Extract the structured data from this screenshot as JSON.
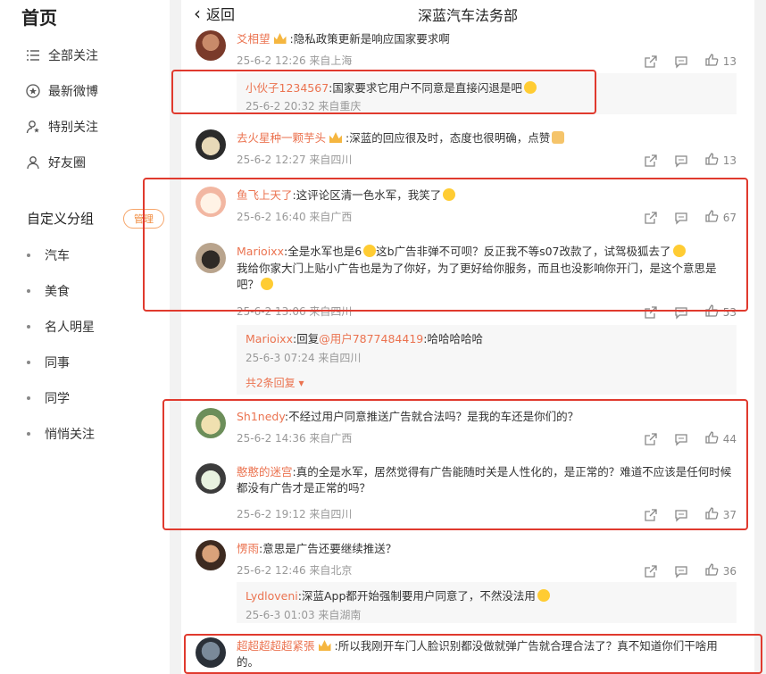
{
  "sidebar": {
    "home": "首页",
    "nav": [
      {
        "label": "全部关注",
        "icon": "list-icon"
      },
      {
        "label": "最新微博",
        "icon": "star-circle-icon"
      },
      {
        "label": "特别关注",
        "icon": "user-star-icon"
      },
      {
        "label": "好友圈",
        "icon": "user-icon"
      }
    ],
    "group_header": "自定义分组",
    "manage": "管理",
    "groups": [
      "汽车",
      "美食",
      "名人明星",
      "同事",
      "同学",
      "悄悄关注"
    ]
  },
  "header": {
    "back": "返回",
    "title": "深蓝汽车法务部"
  },
  "comments": [
    {
      "user": "爻相望",
      "text": ":隐私政策更新是响应国家要求啊",
      "meta": "25-6-2 12:26 来自上海",
      "likes": "13"
    },
    {
      "user": "小伙子1234567",
      "text": ":国家要求它用户不同意是直接闪退是吧",
      "meta": "25-6-2 20:32 来自重庆"
    },
    {
      "user": "去火星种一颗芋头",
      "text": ":深蓝的回应很及时，态度也很明确，点赞",
      "meta": "25-6-2 12:27 来自四川",
      "likes": "13"
    },
    {
      "user": "鱼飞上天了",
      "text": ":这评论区清一色水军，我笑了",
      "meta": "25-6-2 16:40 来自广西",
      "likes": "67"
    },
    {
      "user": "Marioixx",
      "text_a": ":全是水军也是6",
      "text_b": "这b广告非弹不可呗？反正我不等s07改款了，试驾极狐去了",
      "text_c": "我给你家大门上贴小广告也是为了你好，为了更好给你服务，而且也没影响你开门，是这个意思是吧？",
      "meta": "25-6-2 13:06 来自四川",
      "likes": "53"
    },
    {
      "reply_user": "Marioixx",
      "reply_text_a": ":回复",
      "reply_mention": "@用户7877484419",
      "reply_text_b": ":哈哈哈哈哈",
      "reply_meta": "25-6-3 07:24 来自四川",
      "more": "共2条回复"
    },
    {
      "user": "Sh1nedy",
      "text": ":不经过用户同意推送广告就合法吗？是我的车还是你们的？",
      "meta": "25-6-2 14:36 来自广西",
      "likes": "44"
    },
    {
      "user": "憨憨的迷宫",
      "text": ":真的全是水军，居然觉得有广告能随时关是人性化的，是正常的？难道不应该是任何时候都没有广告才是正常的吗？",
      "meta": "25-6-2 19:12 来自四川",
      "likes": "37"
    },
    {
      "user": "愣雨",
      "text": ":意思是广告还要继续推送？",
      "meta": "25-6-2 12:46 来自北京",
      "likes": "36"
    },
    {
      "reply_user": "Lydloveni",
      "reply_text": ":深蓝App都开始强制要用户同意了，不然没法用",
      "reply_meta": "25-6-3 01:03 来自湖南"
    },
    {
      "user": "超超超超超紧張",
      "text": ":所以我刚开车门人脸识别都没做就弹广告就合理合法了？真不知道你们干啥用的。"
    }
  ],
  "colors": {
    "accent": "#eb7350",
    "highlight_box": "#e03a2e",
    "manage_badge": "#f08a3c"
  }
}
